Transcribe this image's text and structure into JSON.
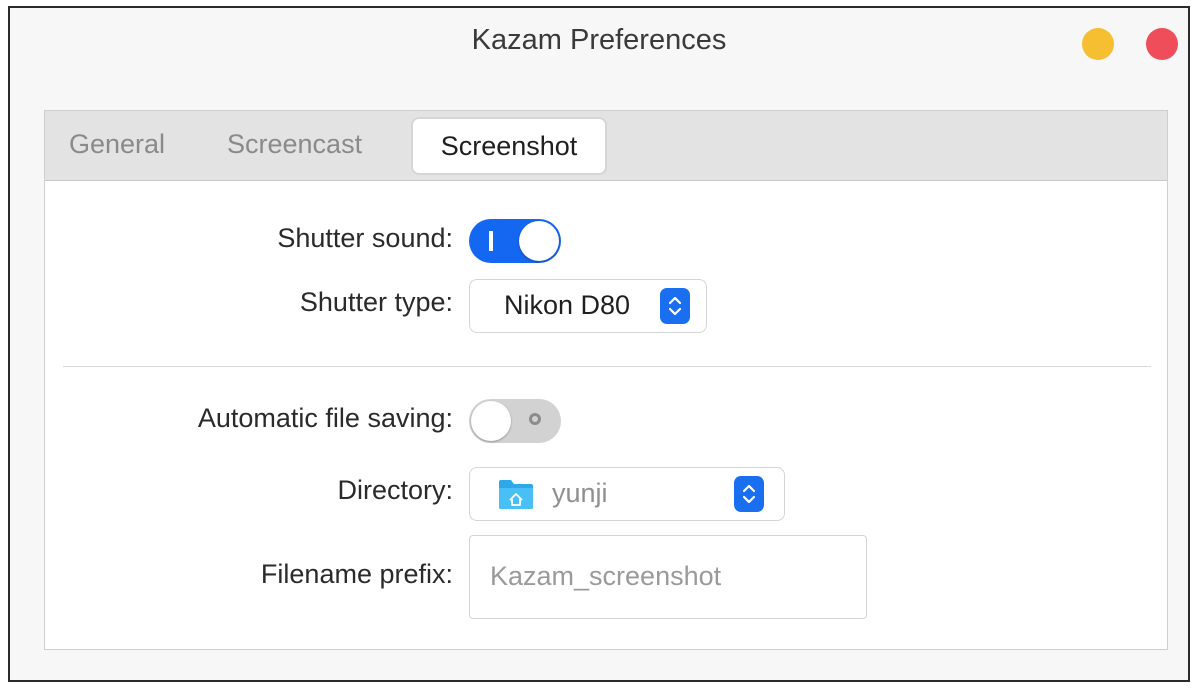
{
  "window": {
    "title": "Kazam Preferences",
    "controls": {
      "minimize_color": "#f6bf32",
      "close_color": "#ef4d5a"
    }
  },
  "tabs": [
    {
      "label": "General",
      "active": false
    },
    {
      "label": "Screencast",
      "active": false
    },
    {
      "label": "Screenshot",
      "active": true
    }
  ],
  "screenshot": {
    "shutter_sound": {
      "label": "Shutter sound:",
      "enabled": true
    },
    "shutter_type": {
      "label": "Shutter type:",
      "value": "Nikon D80"
    },
    "auto_save": {
      "label": "Automatic file saving:",
      "enabled": false
    },
    "directory": {
      "label": "Directory:",
      "value": "yunji",
      "icon": "folder-home-icon"
    },
    "filename_prefix": {
      "label": "Filename prefix:",
      "placeholder": "Kazam_screenshot"
    }
  },
  "colors": {
    "accent": "#1467f0"
  }
}
